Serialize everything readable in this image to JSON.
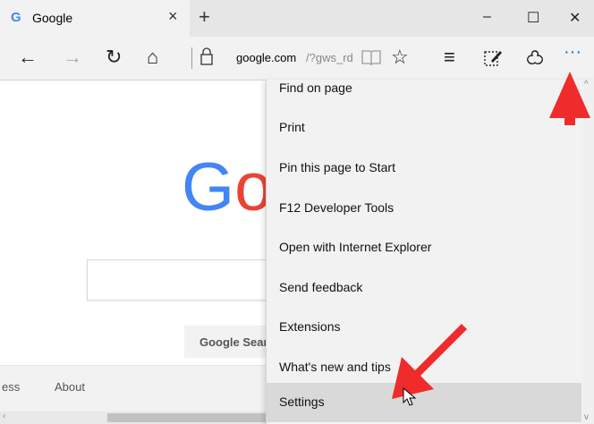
{
  "tab": {
    "favicon": "G",
    "title": "Google"
  },
  "newtab_label": "+",
  "window": {
    "minimize": "–",
    "maximize": "☐",
    "close": "✕"
  },
  "nav": {
    "back": "←",
    "forward": "→",
    "refresh": "↻",
    "home": "⌂",
    "favorite": "☆",
    "hub": "≡",
    "more": "···"
  },
  "address": {
    "host": "google.com",
    "path": "/?gws_rd"
  },
  "page": {
    "logo_letters": [
      {
        "ch": "G",
        "color": "#4285f4"
      },
      {
        "ch": "o",
        "color": "#ea4335"
      }
    ],
    "search_button": "Google Sear",
    "footer_links": [
      "ess",
      "About"
    ]
  },
  "menu": {
    "items": [
      "Find on page",
      "Print",
      "Pin this page to Start",
      "F12 Developer Tools",
      "Open with Internet Explorer",
      "Send feedback",
      "Extensions",
      "What's new and tips",
      "Settings"
    ],
    "highlighted": "Settings"
  },
  "colors": {
    "accent": "#0078d7",
    "annotation_arrow": "#ef2b2b",
    "menu_bg": "#f2f2f2",
    "highlight": "#d9d9d9"
  },
  "icons": [
    "close-icon",
    "new-tab-icon",
    "back-icon",
    "forward-icon",
    "refresh-icon",
    "home-icon",
    "lock-icon",
    "reading-view-icon",
    "favorite-star-icon",
    "hub-icon",
    "web-note-icon",
    "share-icon",
    "more-icon"
  ]
}
